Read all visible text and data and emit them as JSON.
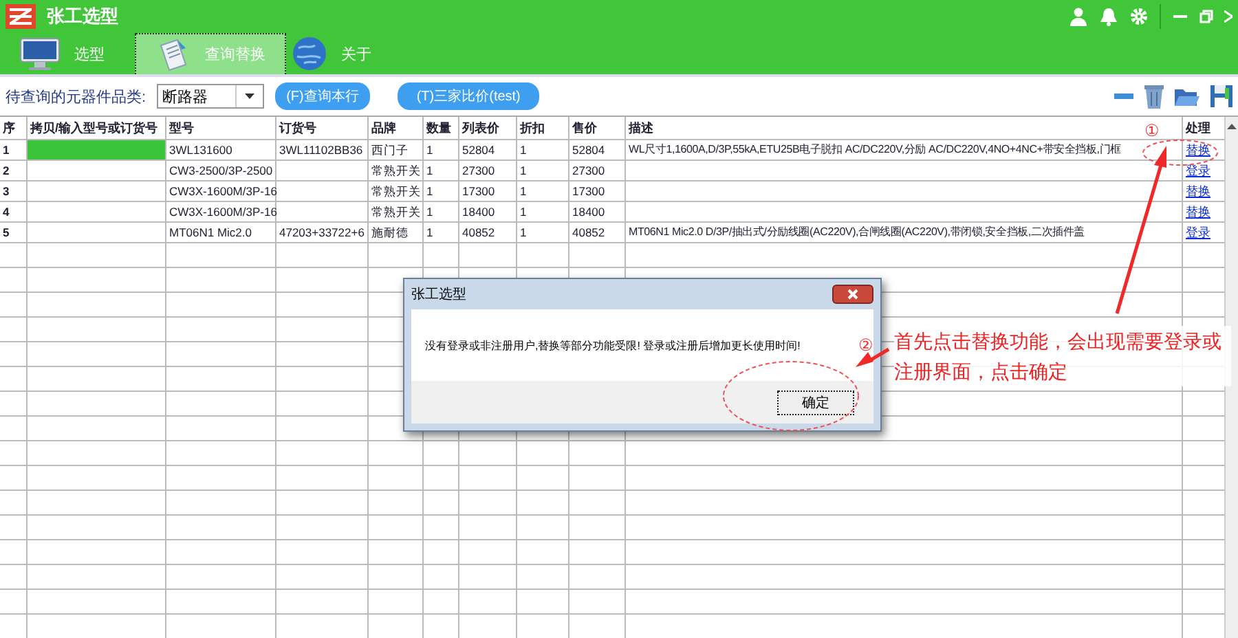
{
  "window": {
    "title": "张工选型"
  },
  "tabs": [
    {
      "label": "选型",
      "selected": false
    },
    {
      "label": "查询替换",
      "selected": true
    },
    {
      "label": "关于",
      "selected": false
    }
  ],
  "toolbar": {
    "label": "待查询的元器件品类:",
    "category": "断路器",
    "buttons": [
      "(F)查询本行",
      "(T)三家比价(test)"
    ]
  },
  "table": {
    "columns": [
      "序",
      "拷贝/输入型号或订货号",
      "型号",
      "订货号",
      "品牌",
      "数量",
      "列表价",
      "折扣",
      "售价",
      "描述",
      "处理"
    ],
    "rows": [
      {
        "cells": [
          "1",
          "",
          "3WL131600",
          "3WL11102BB36",
          "西门子",
          "1",
          "52804",
          "1",
          "52804",
          "WL尺寸1,1600A,D/3P,55kA,ETU25B电子脱扣 AC/DC220V,分励 AC/DC220V,4NO+4NC+带安全挡板,门框"
        ],
        "action": "替换",
        "selected": true
      },
      {
        "cells": [
          "2",
          "",
          "CW3-2500/3P-2500",
          "",
          "常熟开关",
          "1",
          "27300",
          "1",
          "27300",
          ""
        ],
        "action": "登录",
        "selected": false
      },
      {
        "cells": [
          "3",
          "",
          "CW3X-1600M/3P-16",
          "",
          "常熟开关",
          "1",
          "17300",
          "1",
          "17300",
          ""
        ],
        "action": "替换",
        "selected": false
      },
      {
        "cells": [
          "4",
          "",
          "CW3X-1600M/3P-16",
          "",
          "常熟开关",
          "1",
          "18400",
          "1",
          "18400",
          ""
        ],
        "action": "替换",
        "selected": false
      },
      {
        "cells": [
          "5",
          "",
          "MT06N1 Mic2.0",
          "47203+33722+6",
          "施耐德",
          "1",
          "40852",
          "1",
          "40852",
          "MT06N1 Mic2.0 D/3P/抽出式/分励线圈(AC220V),合闸线圈(AC220V),带闭锁,安全挡板,二次插件盖"
        ],
        "action": "登录",
        "selected": false
      }
    ]
  },
  "dialog": {
    "title": "张工选型",
    "message": "没有登录或非注册用户,替换等部分功能受限! 登录或注册后增加更长使用时间!",
    "button": "确定"
  },
  "annotations": {
    "marks": [
      "①",
      "②"
    ],
    "note": "首先点击替换功能，会出现需要登录或注册界面，点击确定"
  }
}
